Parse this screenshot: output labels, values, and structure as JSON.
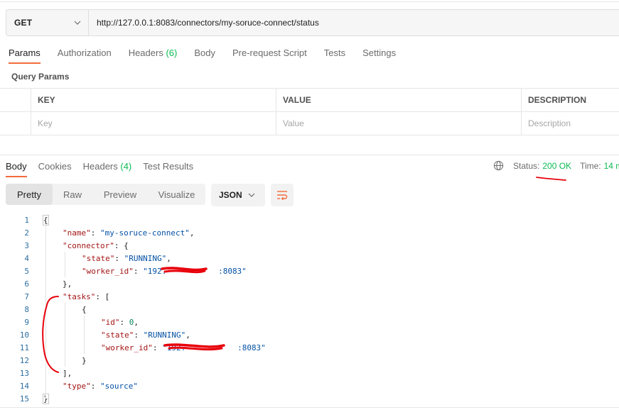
{
  "request": {
    "method": "GET",
    "url": "http://127.0.0.1:8083/connectors/my-soruce-connect/status"
  },
  "request_tabs": [
    {
      "label": "Params",
      "count": ""
    },
    {
      "label": "Authorization",
      "count": ""
    },
    {
      "label": "Headers",
      "count": "(6)"
    },
    {
      "label": "Body",
      "count": ""
    },
    {
      "label": "Pre-request Script",
      "count": ""
    },
    {
      "label": "Tests",
      "count": ""
    },
    {
      "label": "Settings",
      "count": ""
    }
  ],
  "query_params": {
    "title": "Query Params",
    "headers": {
      "key": "KEY",
      "value": "VALUE",
      "description": "DESCRIPTION"
    },
    "placeholders": {
      "key": "Key",
      "value": "Value",
      "description": "Description"
    }
  },
  "response_tabs": [
    {
      "label": "Body",
      "count": ""
    },
    {
      "label": "Cookies",
      "count": ""
    },
    {
      "label": "Headers",
      "count": "(4)"
    },
    {
      "label": "Test Results",
      "count": ""
    }
  ],
  "response_meta": {
    "status_label": "Status:",
    "status_value": "200 OK",
    "time_label": "Time:",
    "time_value": "14 m"
  },
  "view_modes": [
    "Pretty",
    "Raw",
    "Preview",
    "Visualize"
  ],
  "format": "JSON",
  "code_lines": [
    {
      "n": "1",
      "indent": 0,
      "parts": [
        [
          "p",
          "{"
        ]
      ]
    },
    {
      "n": "2",
      "indent": 1,
      "parts": [
        [
          "k",
          "\"name\""
        ],
        [
          "p",
          ": "
        ],
        [
          "s",
          "\"my-soruce-connect\""
        ],
        [
          "p",
          ","
        ]
      ]
    },
    {
      "n": "3",
      "indent": 1,
      "parts": [
        [
          "k",
          "\"connector\""
        ],
        [
          "p",
          ": {"
        ]
      ]
    },
    {
      "n": "4",
      "indent": 2,
      "parts": [
        [
          "k",
          "\"state\""
        ],
        [
          "p",
          ": "
        ],
        [
          "s",
          "\"RUNNING\""
        ],
        [
          "p",
          ","
        ]
      ]
    },
    {
      "n": "5",
      "indent": 2,
      "parts": [
        [
          "k",
          "\"worker_id\""
        ],
        [
          "p",
          ": "
        ],
        [
          "s",
          "\"192.           :8083\""
        ]
      ]
    },
    {
      "n": "6",
      "indent": 1,
      "parts": [
        [
          "p",
          "},"
        ]
      ]
    },
    {
      "n": "7",
      "indent": 1,
      "parts": [
        [
          "k",
          "\"tasks\""
        ],
        [
          "p",
          ": ["
        ]
      ]
    },
    {
      "n": "8",
      "indent": 2,
      "parts": [
        [
          "p",
          "{"
        ]
      ]
    },
    {
      "n": "9",
      "indent": 3,
      "parts": [
        [
          "k",
          "\"id\""
        ],
        [
          "p",
          ": "
        ],
        [
          "n",
          "0"
        ],
        [
          "p",
          ","
        ]
      ]
    },
    {
      "n": "10",
      "indent": 3,
      "parts": [
        [
          "k",
          "\"state\""
        ],
        [
          "p",
          ": "
        ],
        [
          "s",
          "\"RUNNING\""
        ],
        [
          "p",
          ","
        ]
      ]
    },
    {
      "n": "11",
      "indent": 3,
      "parts": [
        [
          "k",
          "\"worker_id\""
        ],
        [
          "p",
          ": "
        ],
        [
          "s",
          "\"192.           :8083\""
        ]
      ]
    },
    {
      "n": "12",
      "indent": 2,
      "parts": [
        [
          "p",
          "}"
        ]
      ]
    },
    {
      "n": "13",
      "indent": 1,
      "parts": [
        [
          "p",
          "],"
        ]
      ]
    },
    {
      "n": "14",
      "indent": 1,
      "parts": [
        [
          "k",
          "\"type\""
        ],
        [
          "p",
          ": "
        ],
        [
          "s",
          "\"source\""
        ]
      ]
    },
    {
      "n": "15",
      "indent": 0,
      "parts": [
        [
          "p",
          "}"
        ]
      ]
    }
  ],
  "colors": {
    "accent_tab": "#f26b3a",
    "status_green": "#0cbb52",
    "annotation_red": "#e8000b",
    "json_key": "#a31515",
    "json_string": "#0451a5",
    "json_number": "#098658"
  }
}
